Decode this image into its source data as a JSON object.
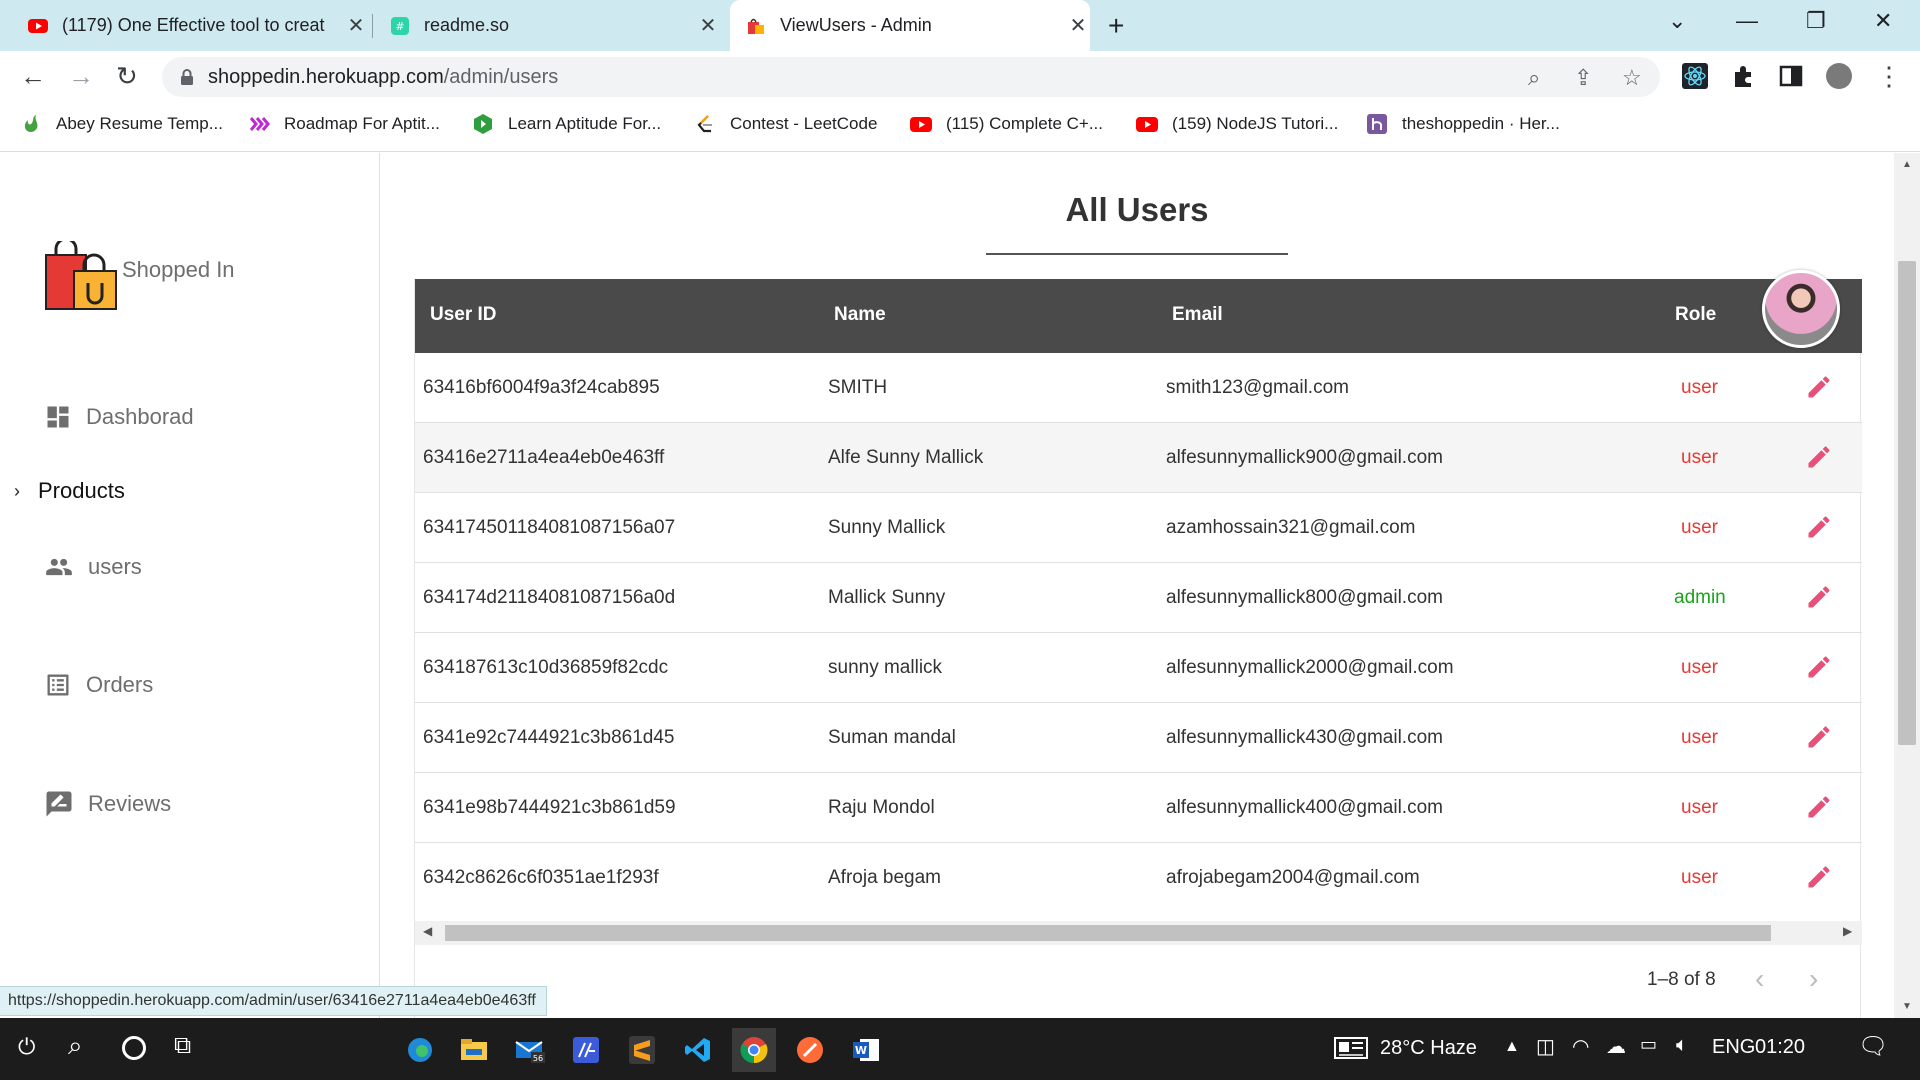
{
  "browser": {
    "tabs": [
      {
        "title": "(1179) One Effective tool to creat",
        "icon": "youtube-icon",
        "active": false
      },
      {
        "title": "readme.so",
        "icon": "readme-icon",
        "active": false
      },
      {
        "title": "ViewUsers - Admin",
        "icon": "shop-bag-icon",
        "active": true
      }
    ],
    "url_host": "shoppedin.herokuapp.com",
    "url_path": "/admin/users",
    "bookmarks": [
      {
        "label": "Abey Resume Temp...",
        "icon": "overleaf-icon"
      },
      {
        "label": "Roadmap For Aptit...",
        "icon": "miro-icon"
      },
      {
        "label": "Learn Aptitude For...",
        "icon": "shield-green-icon"
      },
      {
        "label": "Contest - LeetCode",
        "icon": "leetcode-icon"
      },
      {
        "label": "(115) Complete C+...",
        "icon": "youtube-icon"
      },
      {
        "label": "(159) NodeJS Tutori...",
        "icon": "youtube-icon"
      },
      {
        "label": "theshoppedin · Her...",
        "icon": "heroku-icon"
      }
    ],
    "status_url": "https://shoppedin.herokuapp.com/admin/user/63416e2711a4ea4eb0e463ff"
  },
  "sidebar": {
    "brand": "Shopped In",
    "items": [
      {
        "label": "Dashborad",
        "icon": "dashboard-icon"
      },
      {
        "label": "Products",
        "icon": "chevron-right-icon"
      },
      {
        "label": "users",
        "icon": "people-icon"
      },
      {
        "label": "Orders",
        "icon": "list-icon"
      },
      {
        "label": "Reviews",
        "icon": "rate-review-icon"
      }
    ]
  },
  "main": {
    "title": "All Users",
    "columns": [
      "User ID",
      "Name",
      "Email",
      "Role"
    ],
    "rows": [
      {
        "id": "63416bf6004f9a3f24cab895",
        "name": "SMITH",
        "email": "smith123@gmail.com",
        "role": "user"
      },
      {
        "id": "63416e2711a4ea4eb0e463ff",
        "name": "Alfe Sunny Mallick",
        "email": "alfesunnymallick900@gmail.com",
        "role": "user"
      },
      {
        "id": "6341745011840810871 56a07",
        "name": "Sunny Mallick",
        "email": "azamhossain321@gmail.com",
        "role": "user"
      },
      {
        "id": "634174d21184081087156a0d",
        "name": "Mallick Sunny",
        "email": "alfesunnymallick800@gmail.com",
        "role": "admin"
      },
      {
        "id": "634187613c10d36859f82cdc",
        "name": "sunny mallick",
        "email": "alfesunnymallick2000@gmail.com",
        "role": "user"
      },
      {
        "id": "6341e92c7444921c3b861d45",
        "name": "Suman mandal",
        "email": "alfesunnymallick430@gmail.com",
        "role": "user"
      },
      {
        "id": "6341e98b7444921c3b861d59",
        "name": "Raju Mondol",
        "email": "alfesunnymallick400@gmail.com",
        "role": "user"
      },
      {
        "id": "6342c8626c6f0351ae1f293f",
        "name": "Afroja begam",
        "email": "afrojabegam2004@gmail.com",
        "role": "user"
      }
    ],
    "pagination": "1–8 of 8"
  },
  "taskbar": {
    "weather": "28°C  Haze",
    "language": "ENG",
    "time": "01:20"
  },
  "colors": {
    "header_bg": "#4a4a4a",
    "role_user": "#e53935",
    "role_admin": "#1aa31a",
    "edit_icon": "#e8507a"
  }
}
